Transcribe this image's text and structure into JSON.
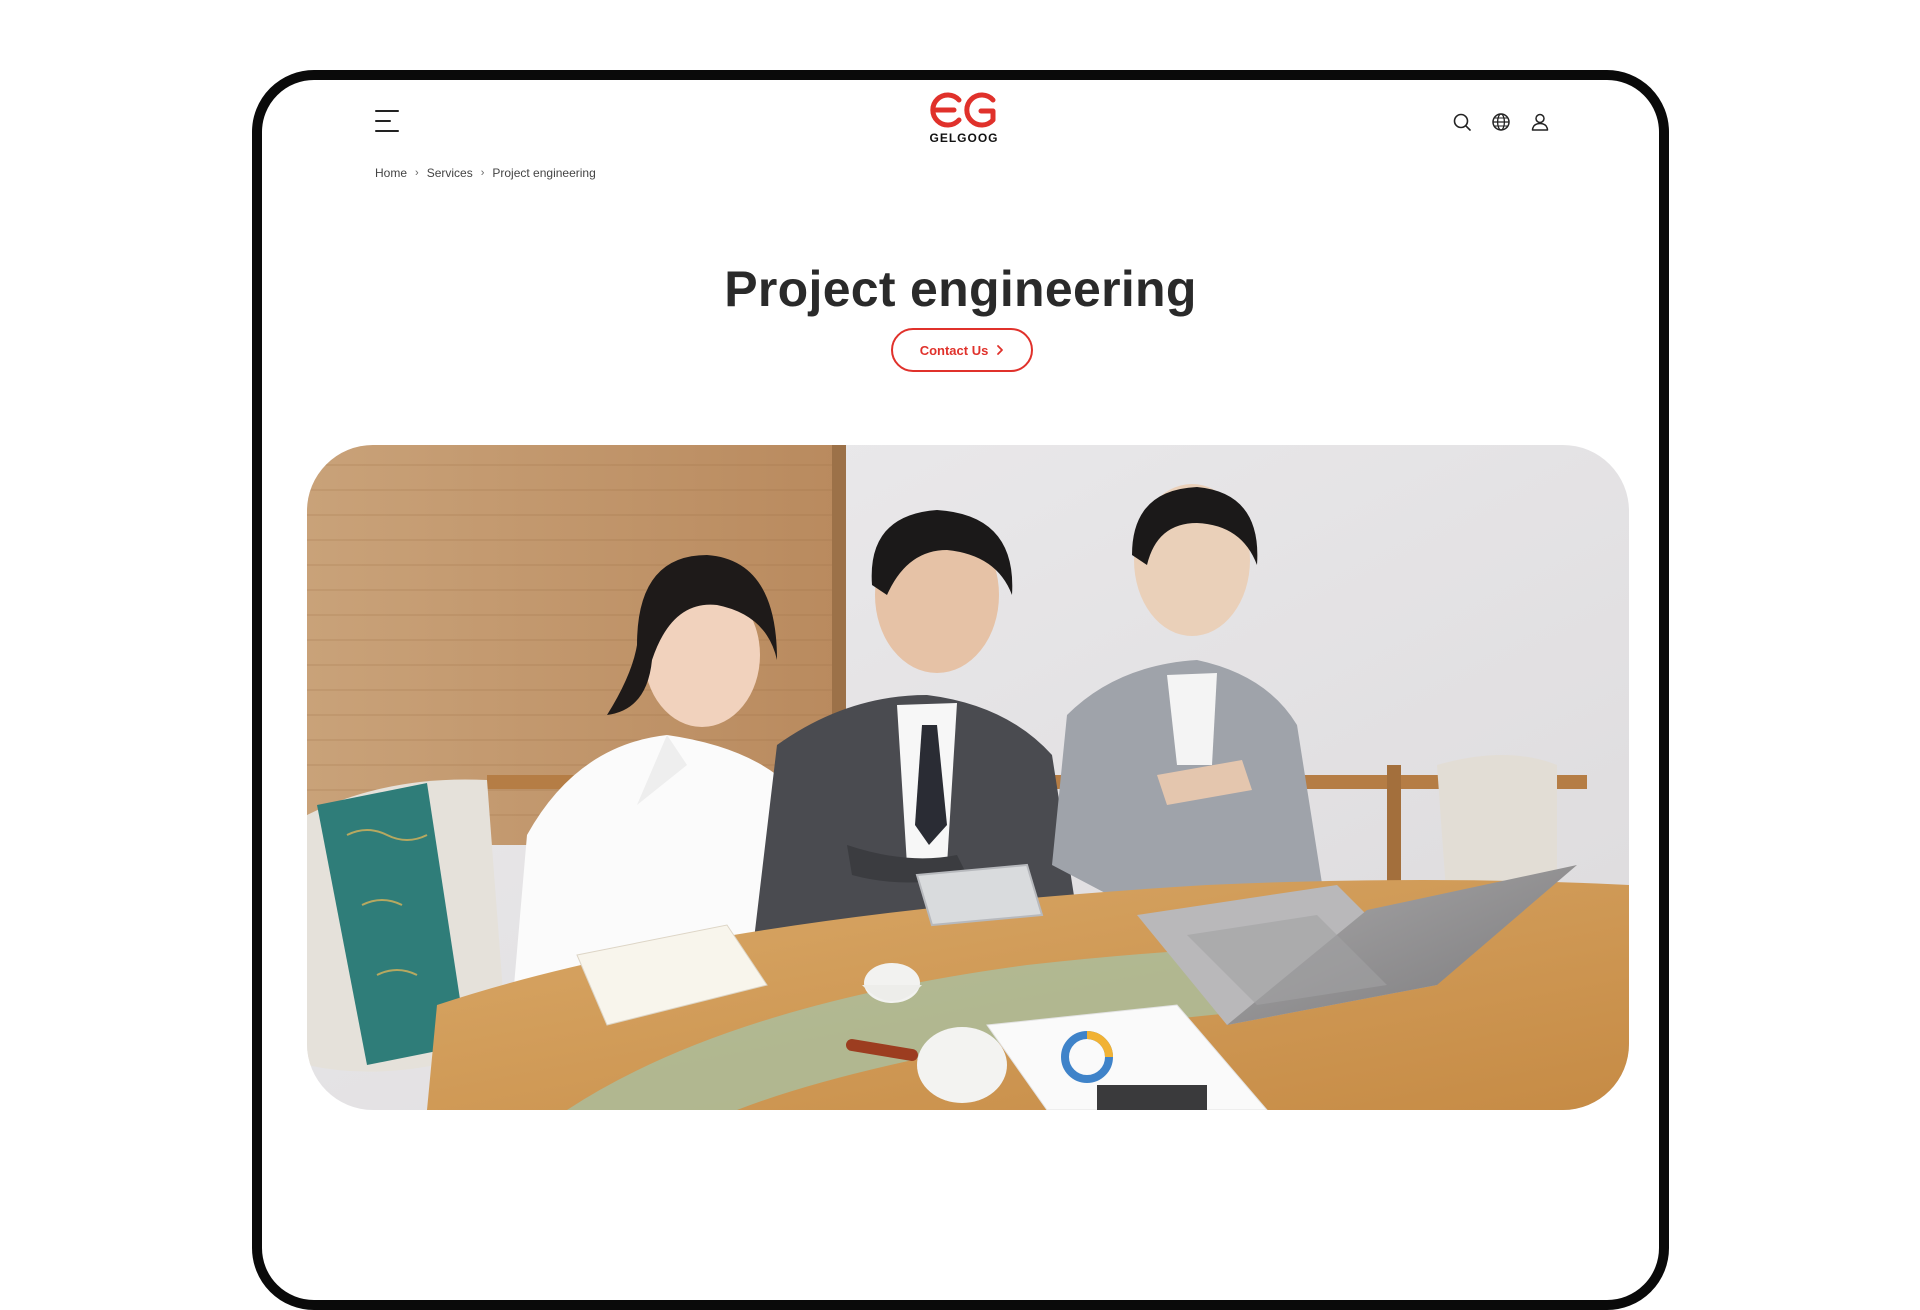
{
  "brand": {
    "name": "GELGOOG",
    "color": "#e0312b"
  },
  "header": {
    "menu_icon": "hamburger-menu-icon",
    "icons": [
      "search-icon",
      "globe-icon",
      "user-icon"
    ]
  },
  "breadcrumb": {
    "items": [
      {
        "label": "Home"
      },
      {
        "label": "Services"
      },
      {
        "label": "Project engineering"
      }
    ]
  },
  "hero": {
    "title": "Project engineering",
    "cta_label": "Contact Us",
    "cta_icon": "chevron-right-icon",
    "image": "business-meeting-photo"
  }
}
